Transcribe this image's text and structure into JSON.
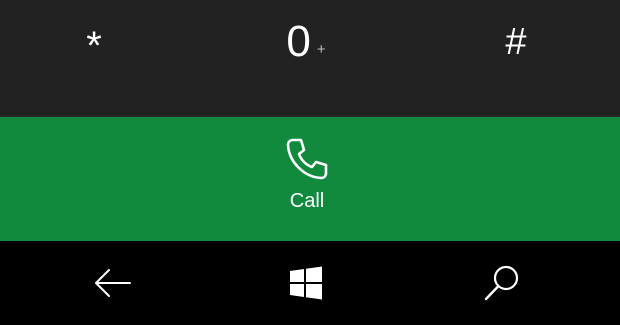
{
  "dialpad": {
    "keys": [
      {
        "main": "*",
        "sub": ""
      },
      {
        "main": "0",
        "sub": "+"
      },
      {
        "main": "#",
        "sub": ""
      }
    ]
  },
  "call": {
    "label": "Call",
    "icon": "phone-icon",
    "color": "#128a3e"
  },
  "navbar": {
    "icons": [
      "back-arrow-icon",
      "windows-logo-icon",
      "search-icon"
    ]
  },
  "colors": {
    "dialpad_background": "#222222",
    "navbar_background": "#000000",
    "call_background": "#128a3e"
  }
}
